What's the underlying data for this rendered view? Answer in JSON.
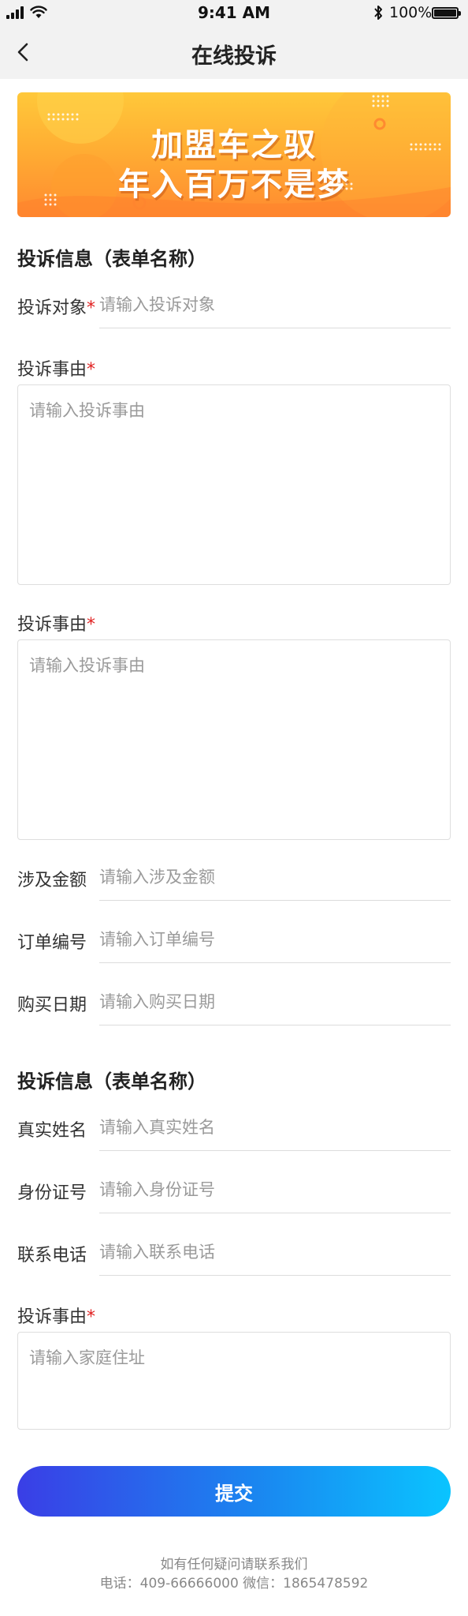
{
  "status_bar": {
    "time": "9:41 AM",
    "battery_text": "100%",
    "battery_level": 1.0
  },
  "nav": {
    "title": "在线投诉",
    "back_icon": "chevron-left-icon"
  },
  "banner": {
    "line1": "加盟车之驭",
    "line2": "年入百万不是梦"
  },
  "section1": {
    "title": "投诉信息（表单名称）",
    "fields": [
      {
        "label": "投诉对象",
        "required_mark": "*",
        "placeholder": "请输入投诉对象"
      }
    ],
    "textareas": [
      {
        "label": "投诉事由",
        "required_mark": "*",
        "placeholder": "请输入投诉事由"
      },
      {
        "label": "投诉事由",
        "required_mark": "*",
        "placeholder": "请输入投诉事由"
      }
    ],
    "more_fields": [
      {
        "label": "涉及金额",
        "placeholder": "请输入涉及金额"
      },
      {
        "label": "订单编号",
        "placeholder": "请输入订单编号"
      },
      {
        "label": "购买日期",
        "placeholder": "请输入购买日期"
      }
    ]
  },
  "section2": {
    "title": "投诉信息（表单名称）",
    "fields": [
      {
        "label": "真实姓名",
        "placeholder": "请输入真实姓名"
      },
      {
        "label": "身份证号",
        "placeholder": "请输入身份证号"
      },
      {
        "label": "联系电话",
        "placeholder": "请输入联系电话"
      }
    ],
    "textarea": {
      "label": "投诉事由",
      "required_mark": "*",
      "placeholder": "请输入家庭住址"
    }
  },
  "submit_label": "提交",
  "footer": {
    "line1": "如有任何疑问请联系我们",
    "line2": "电话：409-66666000  微信：1865478592"
  },
  "colors": {
    "required": "#e02020",
    "button_gradient_start": "#3a3ee6",
    "button_gradient_end": "#0ac4ff",
    "banner_top": "#ffc83a",
    "banner_bottom": "#ff8a30"
  }
}
